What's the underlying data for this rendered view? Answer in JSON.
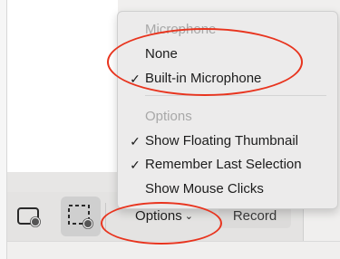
{
  "capture_bar": {
    "options_label": "Options",
    "record_label": "Record",
    "icons": [
      "window-capture-icon",
      "selection-capture-icon",
      "chevron-down-icon"
    ]
  },
  "menu": {
    "microphone_header": "Microphone",
    "microphone_items": [
      {
        "label": "None",
        "checked": false
      },
      {
        "label": "Built-in Microphone",
        "checked": true
      }
    ],
    "options_header": "Options",
    "option_items": [
      {
        "label": "Show Floating Thumbnail",
        "checked": true
      },
      {
        "label": "Remember Last Selection",
        "checked": true
      },
      {
        "label": "Show Mouse Clicks",
        "checked": false
      }
    ],
    "check_glyph": "✓"
  },
  "colors": {
    "annotation": "#e8341e",
    "menu_background": "#ecebeb",
    "header_text": "#a8a8a8"
  }
}
